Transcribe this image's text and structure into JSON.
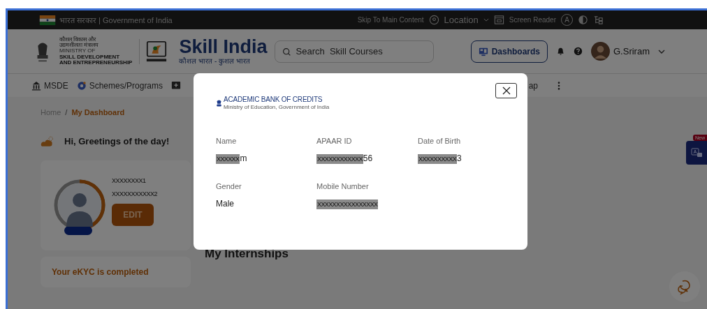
{
  "top_bar": {
    "government_label": "भारत सरकार | Government of India",
    "links": [
      {
        "kind": "text",
        "label": "Skip To Main Content"
      },
      {
        "kind": "location",
        "label": "Location"
      },
      {
        "kind": "screen-reader",
        "label": "Screen Reader"
      },
      {
        "kind": "font-size",
        "label": "A"
      },
      {
        "kind": "contrast"
      },
      {
        "kind": "sitemap"
      }
    ]
  },
  "header": {
    "ministry_lines": [
      "कौशल विकास और",
      "उद्यमशीलता मंत्रालय",
      "MINISTRY OF",
      "SKILL DEVELOPMENT",
      "AND ENTREPRENEURSHIP"
    ],
    "brand_title": "Skill India",
    "brand_tagline": "कौशल भारत - कुशल भारत",
    "search": {
      "placeholder": "Search  Skill Courses"
    },
    "dashboards_button": "Dashboards",
    "user_name": "G.Sriram"
  },
  "nav": {
    "items": [
      {
        "kind": "building",
        "label": "MSDE"
      },
      {
        "kind": "gear",
        "label": "Schemes/Programs"
      },
      {
        "kind": "plus"
      }
    ],
    "trailing_label": "ap"
  },
  "breadcrumb": [
    {
      "label": "Home",
      "selected": false
    },
    {
      "label": "My Dashboard",
      "selected": true
    }
  ],
  "breadcrumb_separator": "/",
  "greeting": "Hi, Greetings of the day!",
  "profile": {
    "level": 0.45,
    "lines": [
      "XXXXXXXX1",
      "XXXXXXXXXXX2"
    ],
    "edit_label": "EDIT"
  },
  "ekyc_status": "Your eKYC is completed",
  "section_title": "My Internships",
  "new_badge": "New",
  "modal": {
    "logo_title": "ACADEMIC BANK OF CREDITS",
    "logo_subtitle": "Ministry of Education, Government of India",
    "fields": [
      {
        "label": "Name",
        "masked": "XXXXXX",
        "visible": "m"
      },
      {
        "label": "APAAR ID",
        "masked": "XXXXXXXXXXXX",
        "visible": "56"
      },
      {
        "label": "Date of Birth",
        "masked": "XXXXXXXXXX",
        "visible": "3"
      },
      {
        "label": "Gender",
        "visible": "Male"
      },
      {
        "label": "Mobile Number",
        "masked": "XXXXXXXXXXXXXXXX"
      }
    ]
  }
}
